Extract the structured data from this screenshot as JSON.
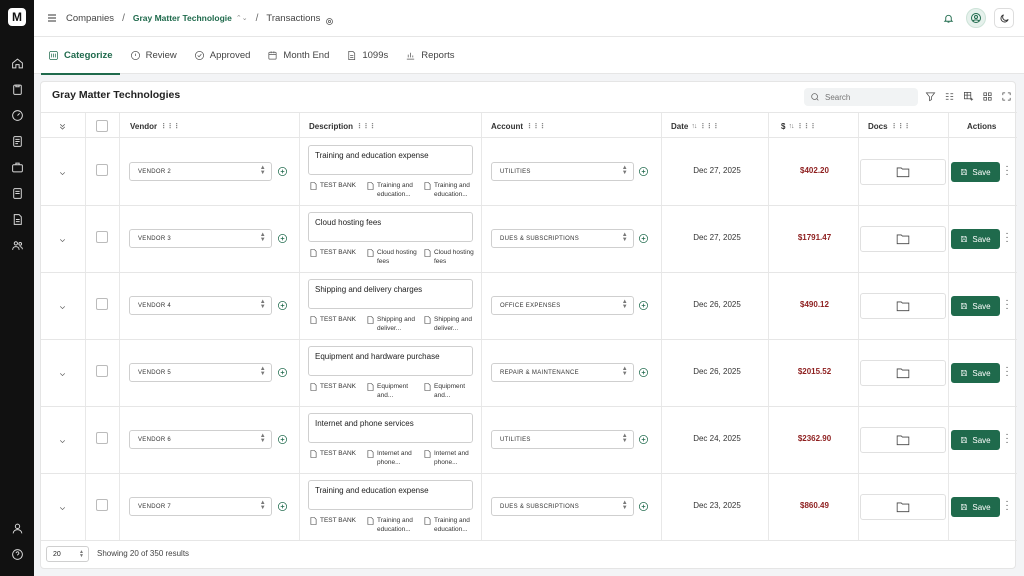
{
  "topbar": {
    "companies_label": "Companies",
    "company_name": "Gray Matter Technologie",
    "page_label": "Transactions",
    "separator": "/"
  },
  "tabs": [
    {
      "label": "Categorize",
      "icon": "categorize-icon",
      "active": true
    },
    {
      "label": "Review",
      "icon": "info-circle-icon"
    },
    {
      "label": "Approved",
      "icon": "check-circle-icon"
    },
    {
      "label": "Month End",
      "icon": "calendar-icon"
    },
    {
      "label": "1099s",
      "icon": "document-icon"
    },
    {
      "label": "Reports",
      "icon": "bar-chart-icon"
    }
  ],
  "card": {
    "title": "Gray Matter Technologies",
    "search_placeholder": "Search"
  },
  "columns": {
    "vendor": "Vendor",
    "description": "Description",
    "account": "Account",
    "date": "Date",
    "amount": "$",
    "docs": "Docs",
    "actions": "Actions"
  },
  "rows": [
    {
      "vendor": "VENDOR 2",
      "description": "Training and education expense",
      "bank": "TEST BANK",
      "tag1": "Training and education...",
      "tag2": "Training and education...",
      "account": "UTILITIES",
      "date": "Dec 27, 2025",
      "amount": "$402.20",
      "save": "Save"
    },
    {
      "vendor": "VENDOR 3",
      "description": "Cloud hosting fees",
      "bank": "TEST BANK",
      "tag1": "Cloud hosting fees",
      "tag2": "Cloud hosting fees",
      "account": "DUES & SUBSCRIPTIONS",
      "date": "Dec 27, 2025",
      "amount": "$1791.47",
      "save": "Save"
    },
    {
      "vendor": "VENDOR 4",
      "description": "Shipping and delivery charges",
      "bank": "TEST BANK",
      "tag1": "Shipping and deliver...",
      "tag2": "Shipping and deliver...",
      "account": "OFFICE EXPENSES",
      "date": "Dec 26, 2025",
      "amount": "$490.12",
      "save": "Save"
    },
    {
      "vendor": "VENDOR 5",
      "description": "Equipment and hardware purchase",
      "bank": "TEST BANK",
      "tag1": "Equipment and...",
      "tag2": "Equipment and...",
      "account": "REPAIR & MAINTENANCE",
      "date": "Dec 26, 2025",
      "amount": "$2015.52",
      "save": "Save"
    },
    {
      "vendor": "VENDOR 6",
      "description": "Internet and phone services",
      "bank": "TEST BANK",
      "tag1": "Internet and phone...",
      "tag2": "Internet and phone...",
      "account": "UTILITIES",
      "date": "Dec 24, 2025",
      "amount": "$2362.90",
      "save": "Save"
    },
    {
      "vendor": "VENDOR 7",
      "description": "Training and education expense",
      "bank": "TEST BANK",
      "tag1": "Training and education...",
      "tag2": "Training and education...",
      "account": "DUES & SUBSCRIPTIONS",
      "date": "Dec 23, 2025",
      "amount": "$860.49",
      "save": "Save"
    }
  ],
  "footer": {
    "page_size": "20",
    "showing_text": "Showing 20 of 350 results"
  },
  "colors": {
    "brand_green": "#1f6a4c",
    "amount_red": "#8e1f1f",
    "rail_bg": "#111111"
  }
}
